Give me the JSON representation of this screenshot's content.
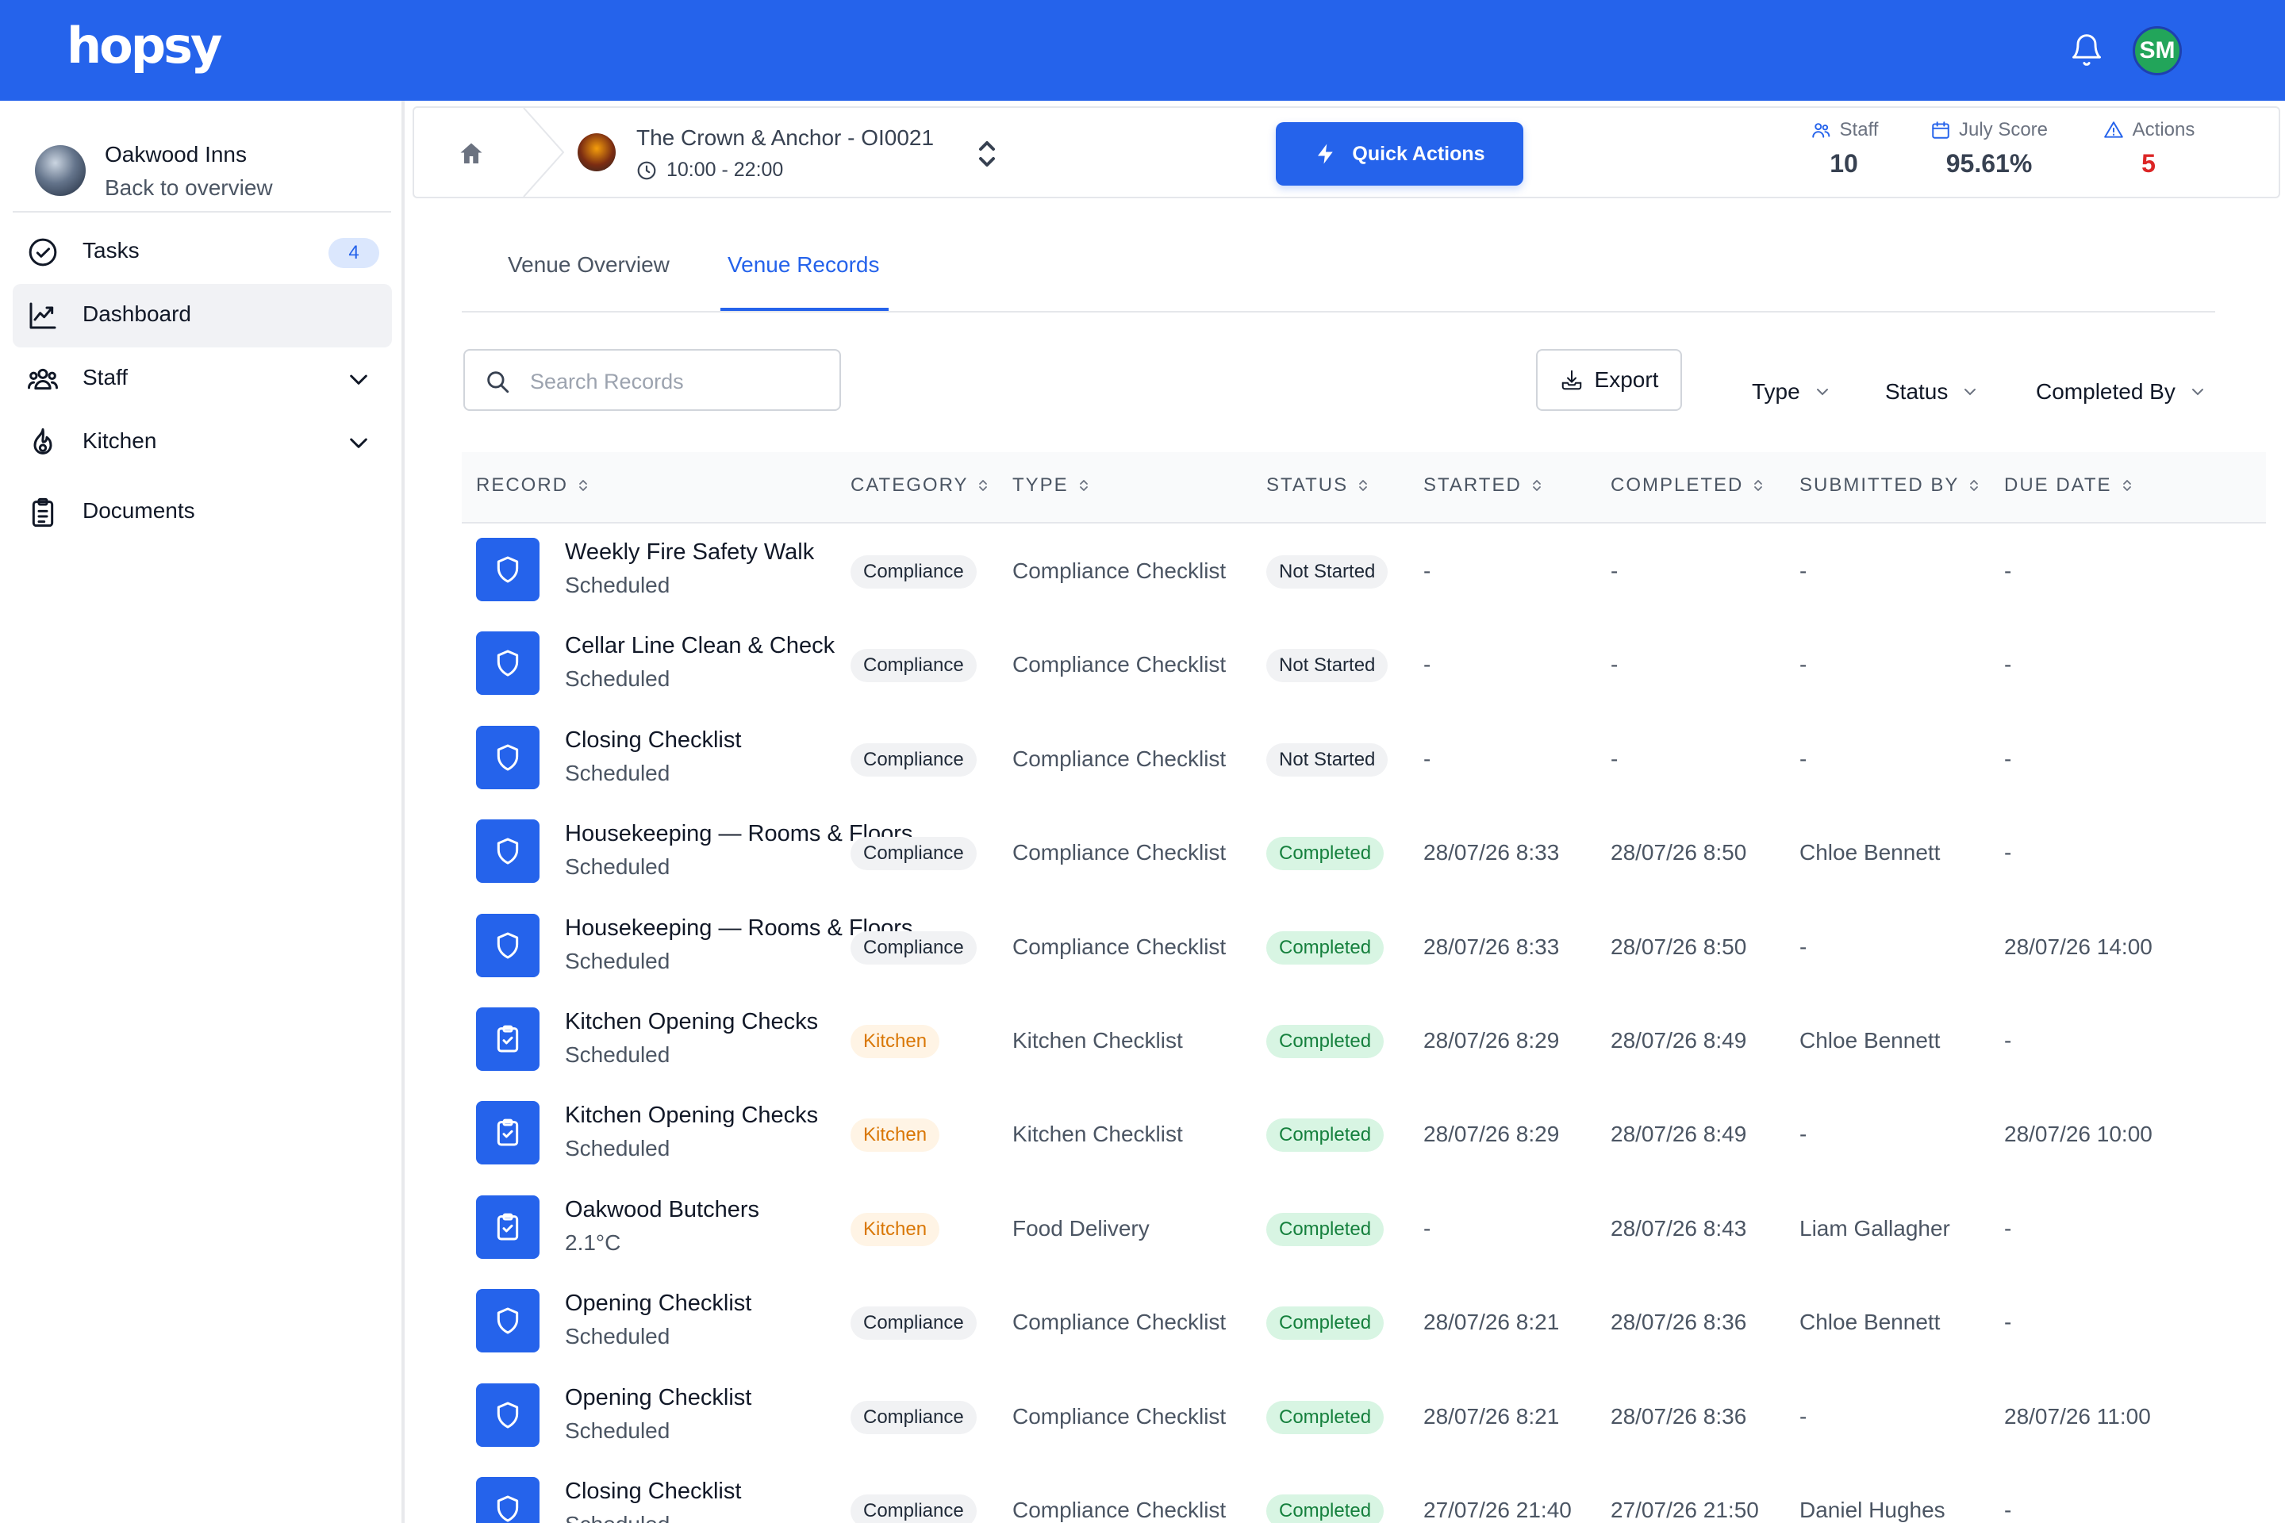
{
  "app": {
    "logo": "hopsy",
    "user_initials": "SM",
    "colors": {
      "primary": "#2563eb",
      "avatar": "#22a55a",
      "actions_red": "#dc2626",
      "completed_green": "#15803d",
      "kitchen_orange": "#d97706"
    }
  },
  "sidebar": {
    "org_name": "Oakwood Inns",
    "org_back": "Back to overview",
    "items": [
      {
        "label": "Tasks",
        "icon": "check-circle-icon",
        "badge": "4"
      },
      {
        "label": "Dashboard",
        "icon": "chart-line-icon",
        "active": true
      },
      {
        "label": "Staff",
        "icon": "users-icon",
        "expandable": true
      },
      {
        "label": "Kitchen",
        "icon": "flame-icon",
        "expandable": true
      },
      {
        "label": "Documents",
        "icon": "clipboard-icon"
      }
    ]
  },
  "venue": {
    "name": "The Crown & Anchor - OI0021",
    "hours": "10:00 - 22:00",
    "quick_actions": "Quick Actions",
    "stats": [
      {
        "label": "Staff",
        "value": "10",
        "icon": "users-icon"
      },
      {
        "label": "July Score",
        "value": "95.61%",
        "icon": "calendar-icon"
      },
      {
        "label": "Actions",
        "value": "5",
        "icon": "warning-icon"
      }
    ]
  },
  "tabs": [
    {
      "label": "Venue Overview",
      "active": false
    },
    {
      "label": "Venue Records",
      "active": true
    }
  ],
  "toolbar": {
    "search_placeholder": "Search Records",
    "export_label": "Export",
    "filters": [
      "Type",
      "Status",
      "Completed By"
    ]
  },
  "table": {
    "columns": [
      "RECORD",
      "CATEGORY",
      "TYPE",
      "STATUS",
      "STARTED",
      "COMPLETED",
      "SUBMITTED BY",
      "DUE DATE"
    ],
    "rows": [
      {
        "icon": "shield-icon",
        "title": "Weekly Fire Safety Walk",
        "subtitle": "Scheduled",
        "category": "Compliance",
        "type": "Compliance Checklist",
        "status": "Not Started",
        "started": "-",
        "completed": "-",
        "submitted_by": "-",
        "due": "-"
      },
      {
        "icon": "shield-icon",
        "title": "Cellar Line Clean & Check",
        "subtitle": "Scheduled",
        "category": "Compliance",
        "type": "Compliance Checklist",
        "status": "Not Started",
        "started": "-",
        "completed": "-",
        "submitted_by": "-",
        "due": "-"
      },
      {
        "icon": "shield-icon",
        "title": "Closing Checklist",
        "subtitle": "Scheduled",
        "category": "Compliance",
        "type": "Compliance Checklist",
        "status": "Not Started",
        "started": "-",
        "completed": "-",
        "submitted_by": "-",
        "due": "-"
      },
      {
        "icon": "shield-icon",
        "title": "Housekeeping — Rooms & Floors",
        "subtitle": "Scheduled",
        "category": "Compliance",
        "type": "Compliance Checklist",
        "status": "Completed",
        "started": "28/07/26 8:33",
        "completed": "28/07/26 8:50",
        "submitted_by": "Chloe Bennett",
        "due": "-"
      },
      {
        "icon": "shield-icon",
        "title": "Housekeeping — Rooms & Floors",
        "subtitle": "Scheduled",
        "category": "Compliance",
        "type": "Compliance Checklist",
        "status": "Completed",
        "started": "28/07/26 8:33",
        "completed": "28/07/26 8:50",
        "submitted_by": "-",
        "due": "28/07/26 14:00"
      },
      {
        "icon": "clipboard-check-icon",
        "title": "Kitchen Opening Checks",
        "subtitle": "Scheduled",
        "category": "Kitchen",
        "type": "Kitchen Checklist",
        "status": "Completed",
        "started": "28/07/26 8:29",
        "completed": "28/07/26 8:49",
        "submitted_by": "Chloe Bennett",
        "due": "-"
      },
      {
        "icon": "clipboard-check-icon",
        "title": "Kitchen Opening Checks",
        "subtitle": "Scheduled",
        "category": "Kitchen",
        "type": "Kitchen Checklist",
        "status": "Completed",
        "started": "28/07/26 8:29",
        "completed": "28/07/26 8:49",
        "submitted_by": "-",
        "due": "28/07/26 10:00"
      },
      {
        "icon": "clipboard-check-icon",
        "title": "Oakwood Butchers",
        "subtitle": "2.1°C",
        "category": "Kitchen",
        "type": "Food Delivery",
        "status": "Completed",
        "started": "-",
        "completed": "28/07/26 8:43",
        "submitted_by": "Liam Gallagher",
        "due": "-"
      },
      {
        "icon": "shield-icon",
        "title": "Opening Checklist",
        "subtitle": "Scheduled",
        "category": "Compliance",
        "type": "Compliance Checklist",
        "status": "Completed",
        "started": "28/07/26 8:21",
        "completed": "28/07/26 8:36",
        "submitted_by": "Chloe Bennett",
        "due": "-"
      },
      {
        "icon": "shield-icon",
        "title": "Opening Checklist",
        "subtitle": "Scheduled",
        "category": "Compliance",
        "type": "Compliance Checklist",
        "status": "Completed",
        "started": "28/07/26 8:21",
        "completed": "28/07/26 8:36",
        "submitted_by": "-",
        "due": "28/07/26 11:00"
      },
      {
        "icon": "shield-icon",
        "title": "Closing Checklist",
        "subtitle": "Scheduled",
        "category": "Compliance",
        "type": "Compliance Checklist",
        "status": "Completed",
        "started": "27/07/26 21:40",
        "completed": "27/07/26 21:50",
        "submitted_by": "Daniel Hughes",
        "due": "-"
      }
    ]
  }
}
